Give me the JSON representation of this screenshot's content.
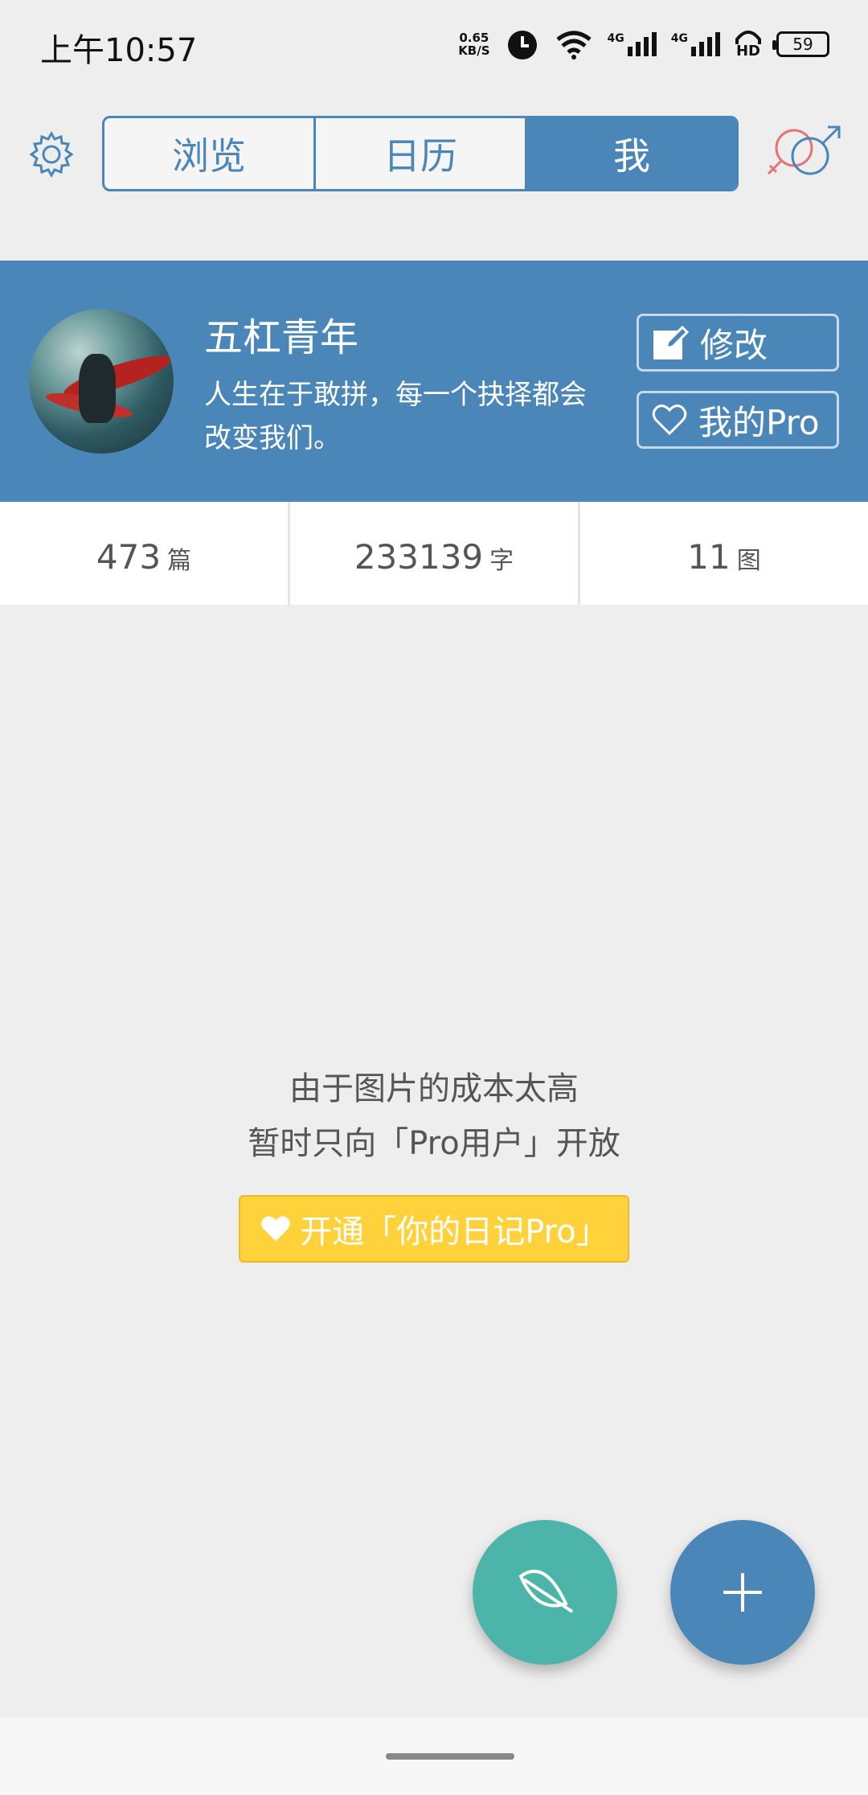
{
  "status": {
    "time": "上午10:57",
    "netspeed_value": "0.65",
    "netspeed_unit": "KB/S",
    "sig1_label": "4G",
    "sig2_label": "4G",
    "hd_label": "HD",
    "battery": "59"
  },
  "nav": {
    "tabs": [
      {
        "label": "浏览",
        "active": false
      },
      {
        "label": "日历",
        "active": false
      },
      {
        "label": "我",
        "active": true
      }
    ]
  },
  "profile": {
    "name": "五杠青年",
    "bio": "人生在于敢拼，每一个抉择都会改变我们。",
    "edit_label": "修改",
    "pro_label": "我的Pro"
  },
  "stats": [
    {
      "value": "473",
      "unit": "篇"
    },
    {
      "value": "233139",
      "unit": "字"
    },
    {
      "value": "11",
      "unit": "图"
    }
  ],
  "message": {
    "line1": "由于图片的成本太高",
    "line2": "暂时只向「Pro用户」开放",
    "button": "开通「你的日记Pro」"
  },
  "colors": {
    "primary": "#4a86b8",
    "accent_yellow": "#ffd13b",
    "fab_green": "#4db4a9"
  }
}
